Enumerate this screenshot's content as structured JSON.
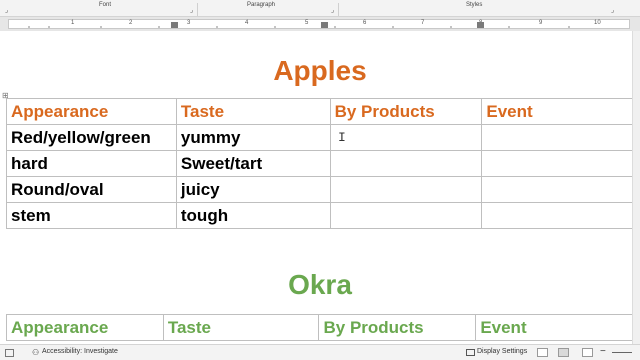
{
  "ribbon": {
    "groups": [
      "Font",
      "Paragraph",
      "Styles"
    ]
  },
  "ruler": {
    "numbers": [
      "1",
      "2",
      "3",
      "4",
      "5",
      "6",
      "7",
      "8",
      "9",
      "10"
    ]
  },
  "document": {
    "apples": {
      "title": "Apples",
      "headers": [
        "Appearance",
        "Taste",
        "By Products",
        "Event"
      ],
      "rows": [
        [
          "Red/yellow/green",
          "yummy",
          "",
          ""
        ],
        [
          "hard",
          "Sweet/tart",
          "",
          ""
        ],
        [
          "Round/oval",
          "juicy",
          "",
          ""
        ],
        [
          "stem",
          "tough",
          "",
          ""
        ]
      ]
    },
    "okra": {
      "title": "Okra",
      "headers": [
        "Appearance",
        "Taste",
        "By Products",
        "Event"
      ]
    },
    "colors": {
      "apples_accent": "#d9691f",
      "okra_accent": "#6aa84f"
    }
  },
  "statusbar": {
    "accessibility": "Accessibility: Investigate",
    "display_settings": "Display Settings"
  },
  "icons": [
    "dialog-launcher-icon",
    "text-cursor-icon",
    "table-move-handle-icon",
    "accessibility-icon",
    "display-settings-icon",
    "view-mode-icons"
  ]
}
